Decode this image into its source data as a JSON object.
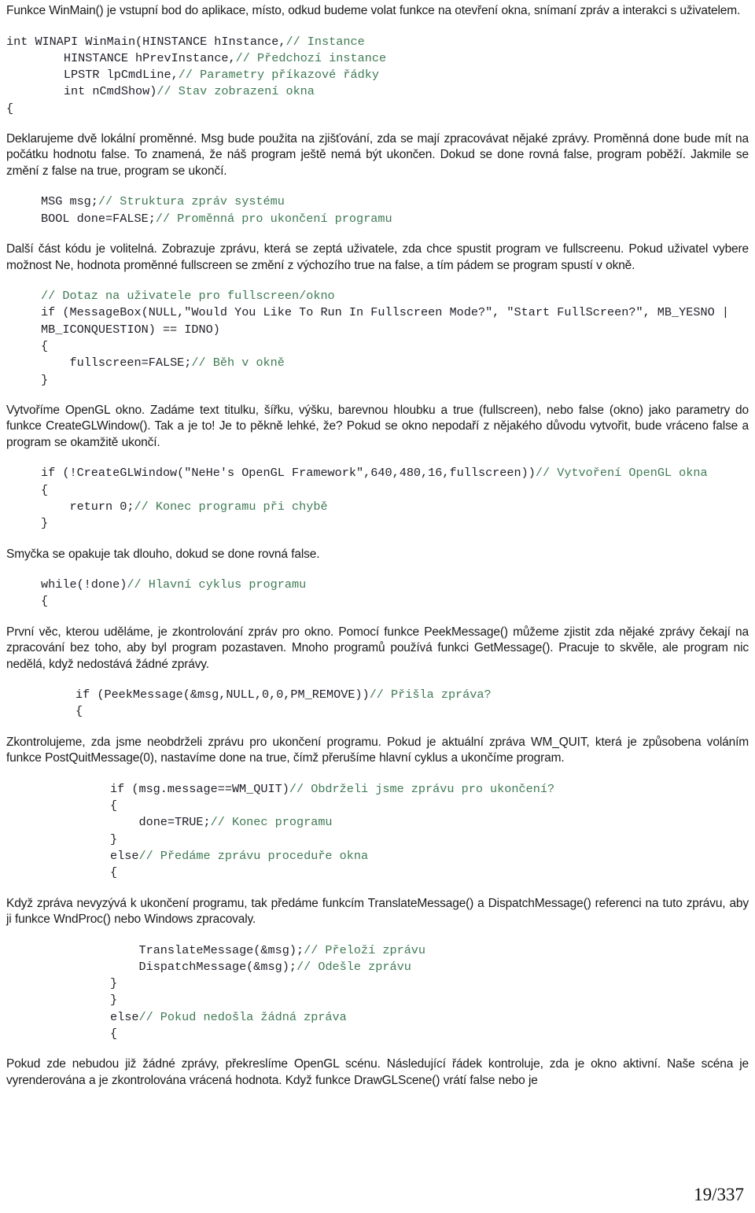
{
  "document": {
    "language": "cs",
    "page_number": "19/337",
    "colors": {
      "body_text": "#1a1a1a",
      "code_text": "#20202a",
      "comment_text": "#3f7a54",
      "background": "#ffffff"
    }
  },
  "blocks": [
    {
      "id": "p1",
      "type": "paragraph",
      "text": "Funkce WinMain() je vstupní bod do aplikace, místo, odkud budeme volat funkce na otevření okna, snímaní zpráv a interakci s uživatelem."
    },
    {
      "id": "c1",
      "type": "code",
      "indent": 0,
      "lines": [
        [
          {
            "t": "code",
            "s": "int WINAPI WinMain(HINSTANCE hInstance,"
          },
          {
            "t": "comment",
            "s": "// Instance"
          }
        ],
        [
          {
            "t": "code",
            "s": "        HINSTANCE hPrevInstance,"
          },
          {
            "t": "comment",
            "s": "// Předchozí instance"
          }
        ],
        [
          {
            "t": "code",
            "s": "        LPSTR lpCmdLine,"
          },
          {
            "t": "comment",
            "s": "// Parametry příkazové řádky"
          }
        ],
        [
          {
            "t": "code",
            "s": "        int nCmdShow)"
          },
          {
            "t": "comment",
            "s": "// Stav zobrazení okna"
          }
        ],
        [
          {
            "t": "code",
            "s": "{"
          }
        ]
      ]
    },
    {
      "id": "p2",
      "type": "paragraph",
      "text": "Deklarujeme dvě lokální proměnné. Msg bude použita na zjišťování, zda se mají zpracovávat nějaké zprávy. Proměnná done bude mít na počátku hodnotu false. To znamená, že náš program ještě nemá být ukončen. Dokud se done rovná false, program poběží. Jakmile se změní z false na true, program se ukončí."
    },
    {
      "id": "c2",
      "type": "code",
      "indent": 1,
      "lines": [
        [
          {
            "t": "code",
            "s": "MSG msg;"
          },
          {
            "t": "comment",
            "s": "// Struktura zpráv systému"
          }
        ],
        [
          {
            "t": "code",
            "s": "BOOL done=FALSE;"
          },
          {
            "t": "comment",
            "s": "// Proměnná pro ukončení programu"
          }
        ]
      ]
    },
    {
      "id": "p3",
      "type": "paragraph",
      "text": "Další část kódu je volitelná. Zobrazuje zprávu, která se zeptá uživatele, zda chce spustit program ve fullscreenu. Pokud uživatel vybere možnost Ne, hodnota proměnné fullscreen se změní z výchozího true na false, a tím pádem se program spustí v okně."
    },
    {
      "id": "c3",
      "type": "code",
      "indent": 1,
      "lines": [
        [
          {
            "t": "comment",
            "s": "// Dotaz na uživatele pro fullscreen/okno"
          }
        ],
        [
          {
            "t": "code",
            "s": "if (MessageBox(NULL,\"Would You Like To Run In Fullscreen Mode?\", \"Start FullScreen?\", MB_YESNO | MB_ICONQUESTION) == IDNO)"
          }
        ],
        [
          {
            "t": "code",
            "s": "{"
          }
        ],
        [
          {
            "t": "code",
            "s": "    fullscreen=FALSE;"
          },
          {
            "t": "comment",
            "s": "// Běh v okně"
          }
        ],
        [
          {
            "t": "code",
            "s": "}"
          }
        ]
      ]
    },
    {
      "id": "p4",
      "type": "paragraph",
      "text": "Vytvoříme OpenGL okno. Zadáme text titulku, šířku, výšku, barevnou hloubku a true (fullscreen), nebo false (okno) jako parametry do funkce CreateGLWindow(). Tak a je to! Je to pěkně lehké, že? Pokud se okno nepodaří z nějakého důvodu vytvořit, bude vráceno false a program se okamžitě ukončí."
    },
    {
      "id": "c4",
      "type": "code",
      "indent": 1,
      "lines": [
        [
          {
            "t": "code",
            "s": "if (!CreateGLWindow(\"NeHe's OpenGL Framework\",640,480,16,fullscreen))"
          },
          {
            "t": "comment",
            "s": "// Vytvoření OpenGL okna"
          }
        ],
        [
          {
            "t": "code",
            "s": "{"
          }
        ],
        [
          {
            "t": "code",
            "s": "    return 0;"
          },
          {
            "t": "comment",
            "s": "// Konec programu při chybě"
          }
        ],
        [
          {
            "t": "code",
            "s": "}"
          }
        ]
      ]
    },
    {
      "id": "p5",
      "type": "paragraph",
      "text": "Smyčka se opakuje tak dlouho, dokud se done rovná false."
    },
    {
      "id": "c5",
      "type": "code",
      "indent": 1,
      "lines": [
        [
          {
            "t": "code",
            "s": "while(!done)"
          },
          {
            "t": "comment",
            "s": "// Hlavní cyklus programu"
          }
        ],
        [
          {
            "t": "code",
            "s": "{"
          }
        ]
      ]
    },
    {
      "id": "p6",
      "type": "paragraph",
      "text": "První věc, kterou uděláme, je zkontrolování zpráv pro okno. Pomocí funkce PeekMessage() můžeme zjistit zda nějaké zprávy čekají na zpracování bez toho, aby byl program pozastaven. Mnoho programů používá funkci GetMessage(). Pracuje to skvěle, ale program nic nedělá, když nedostává žádné zprávy."
    },
    {
      "id": "c6",
      "type": "code",
      "indent": 2,
      "lines": [
        [
          {
            "t": "code",
            "s": "if (PeekMessage(&msg,NULL,0,0,PM_REMOVE))"
          },
          {
            "t": "comment",
            "s": "// Přišla zpráva?"
          }
        ],
        [
          {
            "t": "code",
            "s": "{"
          }
        ]
      ]
    },
    {
      "id": "p7",
      "type": "paragraph",
      "text": "Zkontrolujeme, zda jsme neobdrželi zprávu pro ukončení programu. Pokud je aktuální zpráva WM_QUIT, která je způsobena voláním funkce PostQuitMessage(0), nastavíme done na true, čímž přerušíme hlavní cyklus a ukončíme program."
    },
    {
      "id": "c7",
      "type": "code",
      "indent": 3,
      "lines": [
        [
          {
            "t": "code",
            "s": "if (msg.message==WM_QUIT)"
          },
          {
            "t": "comment",
            "s": "// Obdrželi jsme zprávu pro ukončení?"
          }
        ],
        [
          {
            "t": "code",
            "s": "{"
          }
        ],
        [
          {
            "t": "code",
            "s": "    done=TRUE;"
          },
          {
            "t": "comment",
            "s": "// Konec programu"
          }
        ],
        [
          {
            "t": "code",
            "s": "}"
          }
        ],
        [
          {
            "t": "code",
            "s": "else"
          },
          {
            "t": "comment",
            "s": "// Předáme zprávu proceduře okna"
          }
        ],
        [
          {
            "t": "code",
            "s": "{"
          }
        ]
      ]
    },
    {
      "id": "p8",
      "type": "paragraph",
      "text": "Když zpráva nevyzývá k ukončení programu, tak předáme funkcím TranslateMessage() a DispatchMessage() referenci na tuto zprávu, aby ji funkce WndProc() nebo Windows zpracovaly."
    },
    {
      "id": "c8",
      "type": "code",
      "indent": 3,
      "lines": [
        [
          {
            "t": "code",
            "s": "    TranslateMessage(&msg);"
          },
          {
            "t": "comment",
            "s": "// Přeloží zprávu"
          }
        ],
        [
          {
            "t": "code",
            "s": "    DispatchMessage(&msg);"
          },
          {
            "t": "comment",
            "s": "// Odešle zprávu"
          }
        ],
        [
          {
            "t": "code",
            "s": "}"
          }
        ],
        [
          {
            "t": "code",
            "s": "}"
          }
        ],
        [
          {
            "t": "code",
            "s": "else"
          },
          {
            "t": "comment",
            "s": "// Pokud nedošla žádná zpráva"
          }
        ],
        [
          {
            "t": "code",
            "s": "{"
          }
        ]
      ]
    },
    {
      "id": "p9",
      "type": "paragraph",
      "text": "Pokud zde nebudou již žádné zprávy, překreslíme OpenGL scénu. Následující řádek kontroluje, zda je okno aktivní. Naše scéna je vyrenderována a je zkontrolována vrácená hodnota. Když funkce DrawGLScene() vrátí false nebo je"
    }
  ]
}
